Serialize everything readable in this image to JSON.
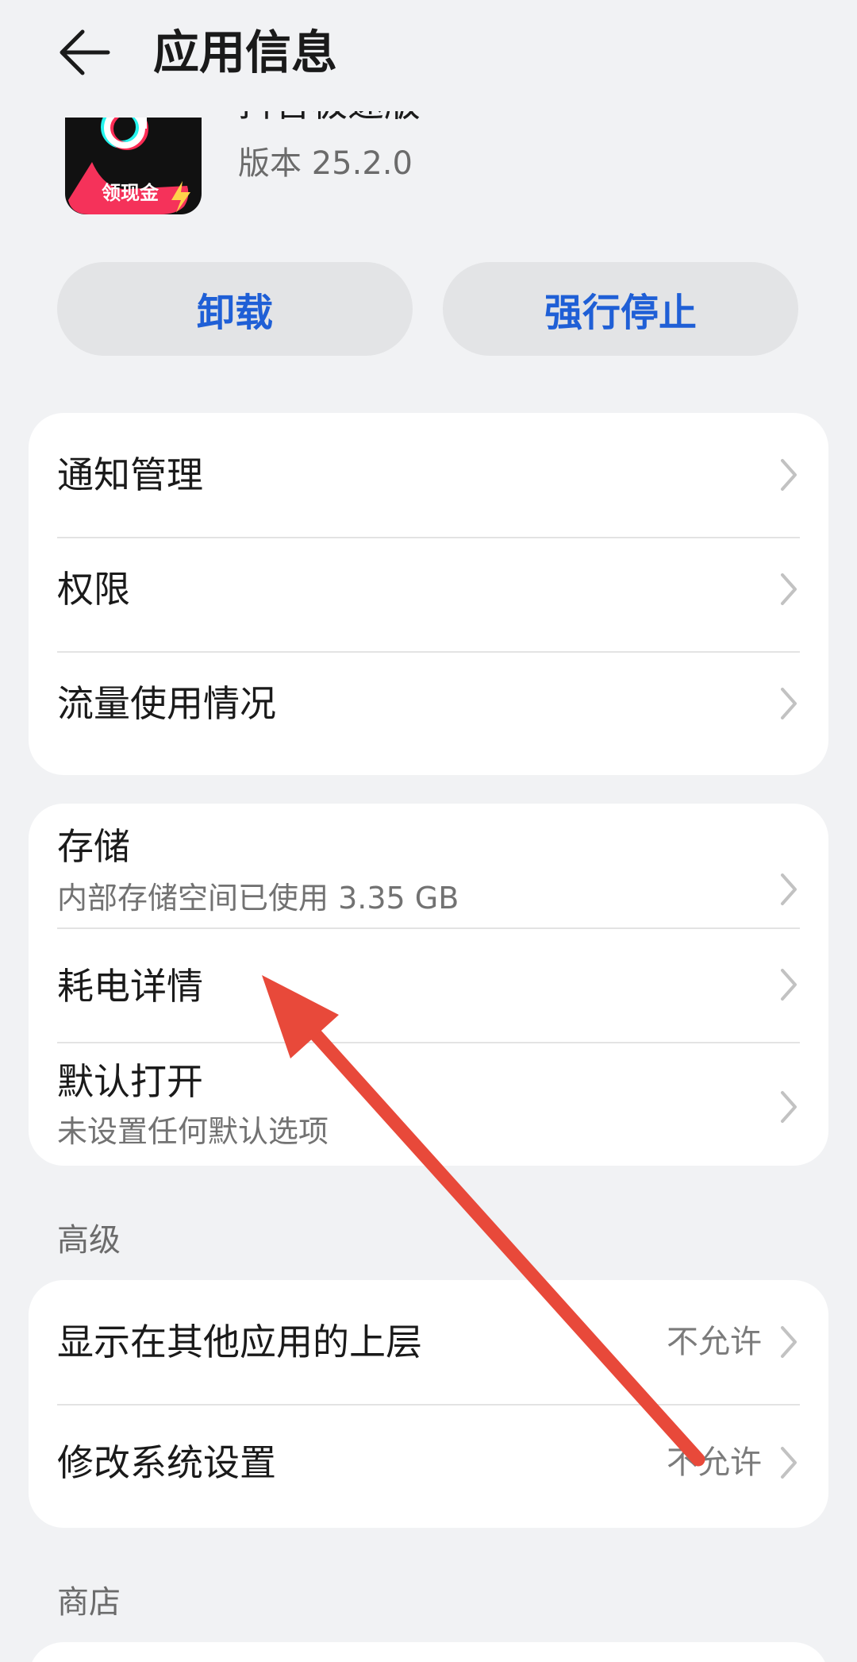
{
  "header": {
    "title": "应用信息"
  },
  "app": {
    "name": "抖音极速版",
    "version": "版本 25.2.0",
    "icon_badge": "领现金"
  },
  "actions": {
    "uninstall": "卸载",
    "force_stop": "强行停止"
  },
  "group1": {
    "items": [
      {
        "label": "通知管理"
      },
      {
        "label": "权限"
      },
      {
        "label": "流量使用情况"
      }
    ]
  },
  "group2": {
    "storage": {
      "label": "存储",
      "sub": "内部存储空间已使用 3.35 GB"
    },
    "battery": {
      "label": "耗电详情"
    },
    "default_open": {
      "label": "默认打开",
      "sub": "未设置任何默认选项"
    }
  },
  "advanced": {
    "title": "高级",
    "items": [
      {
        "label": "显示在其他应用的上层",
        "value": "不允许"
      },
      {
        "label": "修改系统设置",
        "value": "不允许"
      }
    ]
  },
  "store": {
    "title": "商店"
  },
  "colors": {
    "accent": "#1f5fd6",
    "background": "#f1f2f4",
    "annotation_arrow": "#e8493a"
  },
  "icons": {
    "back": "arrow-left-icon",
    "chevron": "chevron-right-icon"
  }
}
